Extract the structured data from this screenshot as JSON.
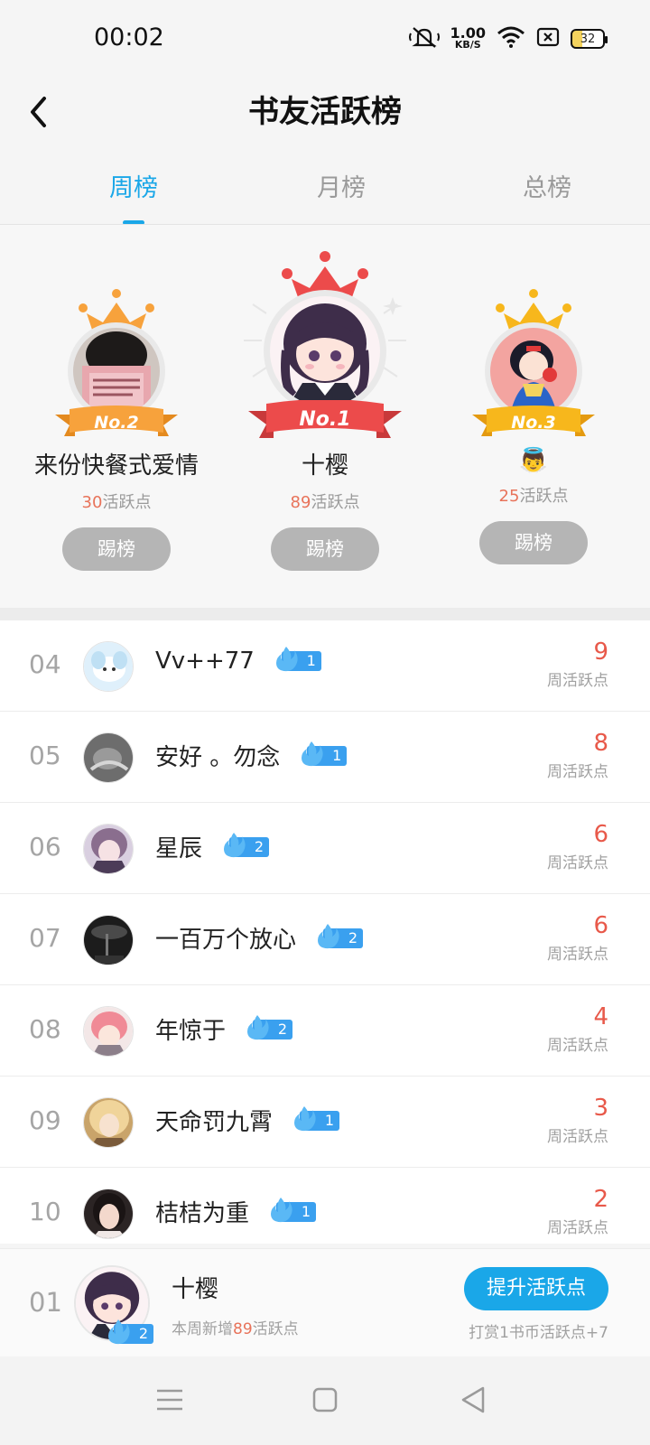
{
  "status_bar": {
    "time": "00:02",
    "speed_value": "1.00",
    "speed_unit": "KB/S",
    "battery": "32",
    "icons": [
      "mute-icon",
      "wifi-icon",
      "sim-icon",
      "battery-icon"
    ]
  },
  "header": {
    "title": "书友活跃榜",
    "back_icon": "chevron-left-icon"
  },
  "tabs": [
    {
      "label": "周榜",
      "active": true
    },
    {
      "label": "月榜",
      "active": false
    },
    {
      "label": "总榜",
      "active": false
    }
  ],
  "podium": [
    {
      "rank_label": "No.2",
      "name": "来份快餐式爱情",
      "points": "30",
      "points_suffix": "活跃点",
      "button": "踢榜",
      "color": "#f7a23c"
    },
    {
      "rank_label": "No.1",
      "name": "十樱",
      "points": "89",
      "points_suffix": "活跃点",
      "button": "踢榜",
      "color": "#ec4b4b"
    },
    {
      "rank_label": "No.3",
      "name": "👼",
      "points": "25",
      "points_suffix": "活跃点",
      "button": "踢榜",
      "color": "#f7b71c"
    }
  ],
  "list": [
    {
      "rank": "04",
      "name": "Vv++77",
      "level": "1",
      "value": "9",
      "value_label": "周活跃点"
    },
    {
      "rank": "05",
      "name": "安好 。勿念",
      "level": "1",
      "value": "8",
      "value_label": "周活跃点"
    },
    {
      "rank": "06",
      "name": "星辰",
      "level": "2",
      "value": "6",
      "value_label": "周活跃点"
    },
    {
      "rank": "07",
      "name": "一百万个放心",
      "level": "2",
      "value": "6",
      "value_label": "周活跃点"
    },
    {
      "rank": "08",
      "name": "年惊于",
      "level": "2",
      "value": "4",
      "value_label": "周活跃点"
    },
    {
      "rank": "09",
      "name": "天命罚九霄",
      "level": "1",
      "value": "3",
      "value_label": "周活跃点"
    },
    {
      "rank": "10",
      "name": "桔桔为重",
      "level": "1",
      "value": "2",
      "value_label": "周活跃点"
    }
  ],
  "my_rank": {
    "rank": "01",
    "name": "十樱",
    "level": "2",
    "sub_prefix": "本周新增",
    "sub_points": "89",
    "sub_suffix": "活跃点",
    "button": "提升活跃点",
    "tip": "打赏1书币活跃点+7"
  },
  "colors": {
    "accent": "#1aa7e8",
    "points": "#e8594a",
    "badge": "#3aa0ef"
  }
}
